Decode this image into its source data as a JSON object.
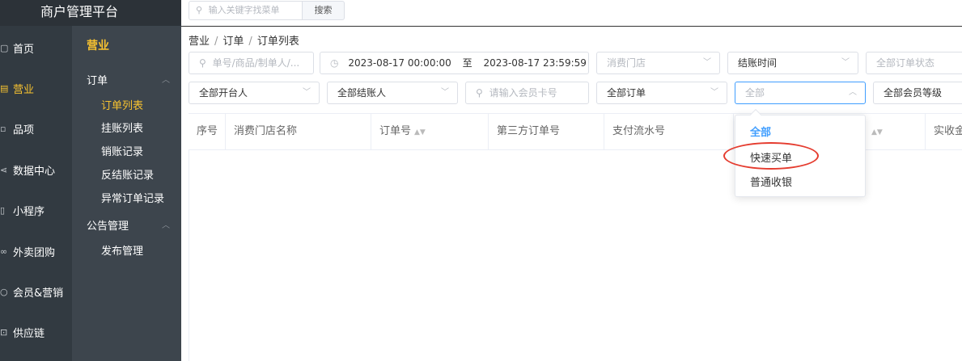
{
  "brand": "商户管理平台",
  "top_search": {
    "placeholder": "输入关键字找菜单",
    "button": "搜索"
  },
  "nav": [
    {
      "label": "首页",
      "icon": "home-icon"
    },
    {
      "label": "营业",
      "icon": "business-icon",
      "active": true
    },
    {
      "label": "品项",
      "icon": "items-icon"
    },
    {
      "label": "数据中心",
      "icon": "share-icon"
    },
    {
      "label": "小程序",
      "icon": "phone-icon"
    },
    {
      "label": "外卖团购",
      "icon": "group-icon"
    },
    {
      "label": "会员&营销",
      "icon": "member-icon"
    },
    {
      "label": "供应链",
      "icon": "truck-icon"
    }
  ],
  "subnav": {
    "header": "营业",
    "group1": "订单",
    "items1": [
      "订单列表",
      "挂账列表",
      "销账记录",
      "反结账记录",
      "异常订单记录"
    ],
    "group2": "公告管理",
    "items2": [
      "发布管理"
    ]
  },
  "breadcrumb": [
    "营业",
    "订单",
    "订单列表"
  ],
  "filters": {
    "keyword_placeholder": "单号/商品/制单人/...",
    "date_start": "2023-08-17 00:00:00",
    "date_to": "至",
    "date_end": "2023-08-17 23:59:59",
    "store_placeholder": "消费门店",
    "time_type": "结账时间",
    "order_status_placeholder": "全部订单状态",
    "opener": "全部开台人",
    "checker": "全部结账人",
    "card_placeholder": "请输入会员卡号",
    "order_type": "全部订单",
    "source_placeholder": "全部",
    "member_level": "全部会员等级"
  },
  "table": {
    "headers": [
      "序号",
      "消费门店名称",
      "订单号",
      "第三方订单号",
      "支付流水号",
      "实收金"
    ]
  },
  "dropdown": {
    "options": [
      "全部",
      "快速买单",
      "普通收银"
    ],
    "selected_index": 0
  },
  "colors": {
    "accent": "#f7c230",
    "primary": "#409eff",
    "highlight": "#e53c2f",
    "sidebar": "#323a41"
  }
}
